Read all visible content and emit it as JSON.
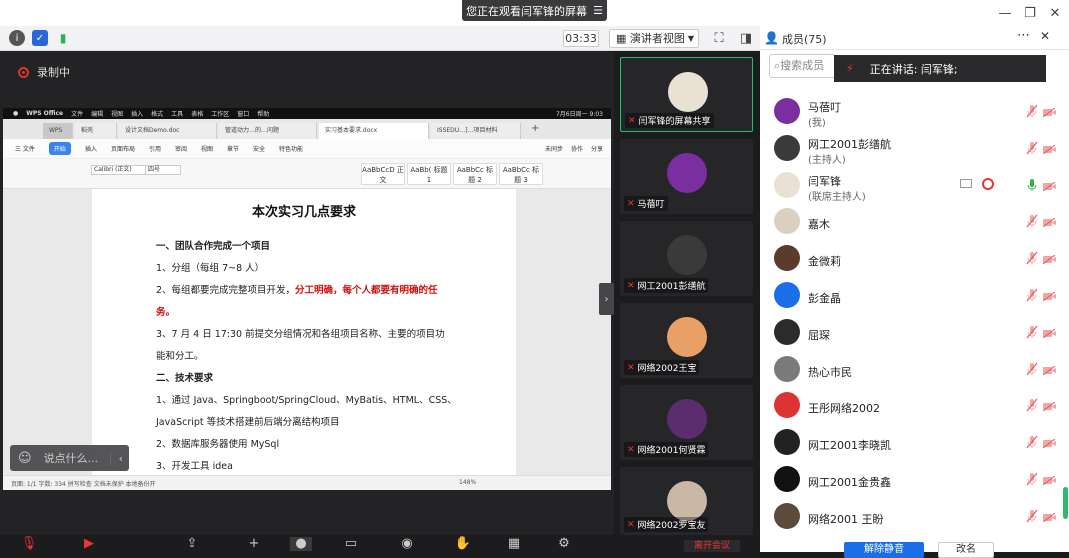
{
  "share_banner": "您正在观看闫军锋的屏幕",
  "toolbar": {
    "timer": "03:33",
    "view_label": "演讲者视图"
  },
  "recording_label": "录制中",
  "chat_placeholder": "说点什么...",
  "wps": {
    "mac_bar": [
      "WPS Office",
      "文件",
      "编辑",
      "视图",
      "插入",
      "格式",
      "工具",
      "表格",
      "工作区",
      "窗口",
      "帮助"
    ],
    "mac_time": "7月6日周一 9:03",
    "tabs": [
      "WPS",
      "稻壳",
      "设计文档Demo.doc",
      "管道动力…的…问题",
      "实习基本要求.docx",
      "ISSEDU…]…项目材料"
    ],
    "menu": [
      "三 文件",
      "开始",
      "插入",
      "页面布局",
      "引用",
      "审阅",
      "视图",
      "章节",
      "安全",
      "特色功能"
    ],
    "menu_right": [
      "未同步",
      "协作",
      "分享"
    ],
    "font_name": "Calibri (正文)",
    "font_size": "四号",
    "styles": [
      "AaBbCcD 正文",
      "AaBb( 标题 1",
      "AaBbCc 标题 2",
      "AaBbCc 标题 3"
    ],
    "status": "页面: 1/1   字数: 334   拼写检查   文档未保护   本地备份开",
    "zoom": "148%"
  },
  "doc": {
    "title": "本次实习几点要求",
    "lines": [
      {
        "text": "一、团队合作完成一个项目",
        "bold": true
      },
      {
        "text": "1、分组（每组 7~8 人）"
      },
      {
        "text": "2、每组都要完成完整项目开发，",
        "red": "分工明确，每个人都要有明确的任"
      },
      {
        "text": "",
        "red": "务。"
      },
      {
        "text": "3、7 月 4 日 17:30 前提交分组情况和各组项目名称、主要的项目功"
      },
      {
        "text": "能和分工。"
      },
      {
        "text": "二、技术要求",
        "bold": true
      },
      {
        "text": "1、通过 Java、Springboot/SpringCloud、MyBatis、HTML、CSS、"
      },
      {
        "text": "JavaScript 等技术搭建前后端分离结构项目"
      },
      {
        "text": "2、数据库服务器使用 MySql"
      },
      {
        "text": "3、开发工具 idea"
      }
    ]
  },
  "video_tiles": [
    {
      "name": "闫军锋的屏幕共享",
      "selected": true,
      "color": "#e9e1d3"
    },
    {
      "name": "马蓓叮",
      "color": "#7b2ea0"
    },
    {
      "name": "网工2001彭缮航",
      "color": "#3a3a3a"
    },
    {
      "name": "网络2002王宝",
      "color": "#e8a066"
    },
    {
      "name": "网络2001何贤霖",
      "color": "#5b2d6e"
    },
    {
      "name": "网络2002罗宝友",
      "color": "#c9b8a6"
    }
  ],
  "panel": {
    "title": "成员(75)",
    "search_placeholder": "搜索成员",
    "speaking_label": "正在讲话: 闫军锋;",
    "members": [
      {
        "name": "马蓓叮",
        "role": "(我)",
        "color": "#7b2ea0"
      },
      {
        "name": "网工2001彭缮航",
        "role": "(主持人)",
        "color": "#3a3a3a"
      },
      {
        "name": "闫军锋",
        "role": "(联席主持人)",
        "color": "#e9e1d3"
      },
      {
        "name": "嘉木",
        "role": "",
        "color": "#d9d0c0"
      },
      {
        "name": "金微莉",
        "role": "",
        "color": "#5a3b2c"
      },
      {
        "name": "彭金晶",
        "role": "",
        "color": "#1a6fe8"
      },
      {
        "name": "屈琛",
        "role": "",
        "color": "#2b2b2b"
      },
      {
        "name": "热心市民",
        "role": "",
        "color": "#7a7a7a"
      },
      {
        "name": "王彤网络2002",
        "role": "",
        "color": "#d33"
      },
      {
        "name": "网工2001李晓凯",
        "role": "",
        "color": "#222"
      },
      {
        "name": "网工2001金贵鑫",
        "role": "",
        "color": "#111"
      },
      {
        "name": "网络2001 王盼",
        "role": "",
        "color": "#5c4b3b"
      }
    ],
    "unmute_label": "解除静音",
    "rename_label": "改名"
  },
  "bottom": {
    "leave_label": "离开会议"
  }
}
